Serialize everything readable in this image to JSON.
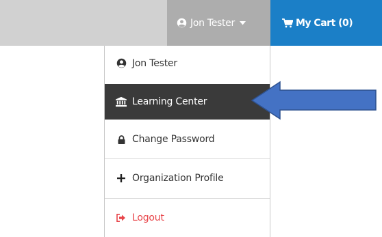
{
  "header": {
    "user_name": "Jon Tester",
    "user_icon": "user-circle-icon",
    "caret_icon": "caret-down-icon",
    "cart_label": "My Cart (0)",
    "cart_icon": "shopping-cart-icon"
  },
  "menu": {
    "items": [
      {
        "label": "Jon Tester",
        "icon": "user-circle-icon"
      },
      {
        "label": "Learning Center",
        "icon": "institution-icon",
        "active": true
      },
      {
        "label": "Change Password",
        "icon": "lock-icon"
      },
      {
        "label": "Organization Profile",
        "icon": "plus-icon"
      },
      {
        "label": "Logout",
        "icon": "sign-out-icon"
      }
    ]
  },
  "annotation": {
    "arrow_color": "#4472c4",
    "arrow_border": "#2f528f",
    "points_to": "Learning Center"
  },
  "colors": {
    "topbar": "#d1d1d1",
    "user_toggle": "#adadad",
    "cart": "#1b7fc7",
    "active_item": "#3a3a3a",
    "logout": "#e8454a"
  }
}
